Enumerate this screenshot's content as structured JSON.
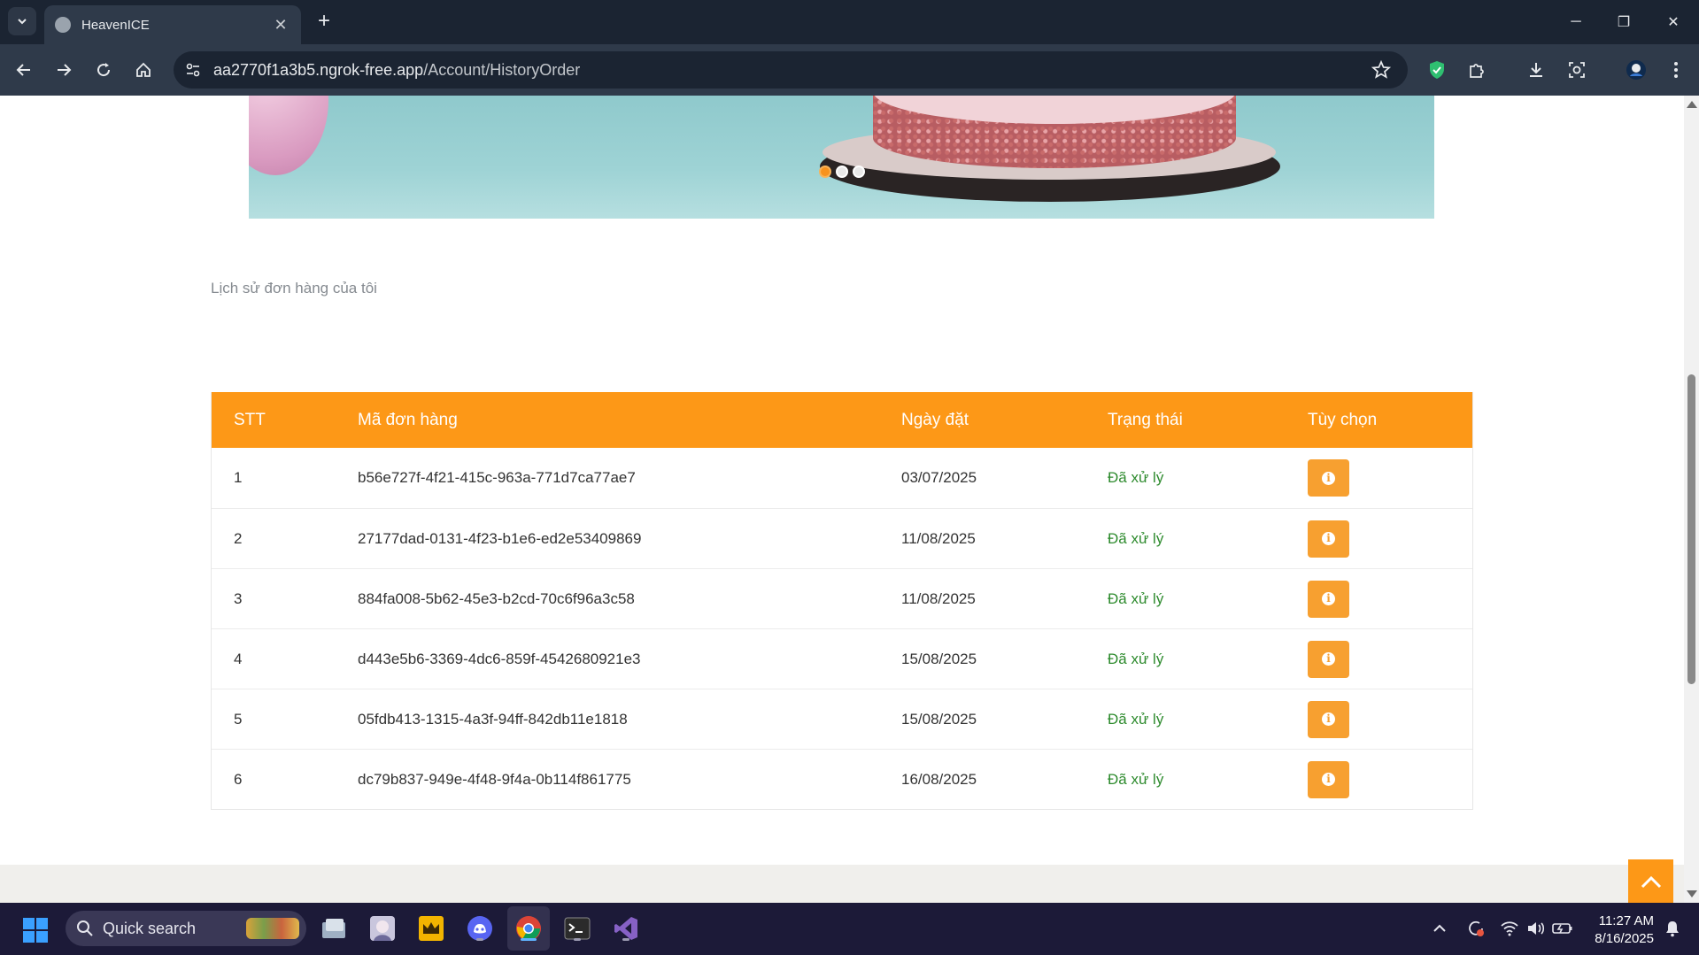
{
  "browser": {
    "tab_title": "HeavenICE",
    "tab_close": "✕",
    "new_tab": "+",
    "url_host": "aa2770f1a3b5.ngrok-free.app",
    "url_path": "/Account/HistoryOrder",
    "window_controls": {
      "minimize": "─",
      "restore": "❐",
      "close": "✕"
    }
  },
  "page": {
    "title": "Lịch sử đơn hàng của tôi",
    "carousel": {
      "slide_count": 3,
      "active_slide": 1
    },
    "table": {
      "headers": [
        "STT",
        "Mã đơn hàng",
        "Ngày đặt",
        "Trạng thái",
        "Tùy chọn"
      ],
      "rows": [
        {
          "stt": "1",
          "order_id": "b56e727f-4f21-415c-963a-771d7ca77ae7",
          "date": "03/07/2025",
          "status": "Đã xử lý"
        },
        {
          "stt": "2",
          "order_id": "27177dad-0131-4f23-b1e6-ed2e53409869",
          "date": "11/08/2025",
          "status": "Đã xử lý"
        },
        {
          "stt": "3",
          "order_id": "884fa008-5b62-45e3-b2cd-70c6f96a3c58",
          "date": "11/08/2025",
          "status": "Đã xử lý"
        },
        {
          "stt": "4",
          "order_id": "d443e5b6-3369-4dc6-859f-4542680921e3",
          "date": "15/08/2025",
          "status": "Đã xử lý"
        },
        {
          "stt": "5",
          "order_id": "05fdb413-1315-4a3f-94ff-842db11e1818",
          "date": "15/08/2025",
          "status": "Đã xử lý"
        },
        {
          "stt": "6",
          "order_id": "dc79b837-949e-4f48-9f4a-0b114f861775",
          "date": "16/08/2025",
          "status": "Đã xử lý"
        }
      ],
      "info_glyph": "i"
    },
    "colors": {
      "accent": "#fd9817",
      "status_done": "#2e8b2e"
    }
  },
  "taskbar": {
    "search_label": "Quick search",
    "time": "11:27 AM",
    "date": "8/16/2025",
    "apps": [
      "file-explorer-icon",
      "anime-app-icon",
      "crown-app-icon",
      "discord-icon",
      "chrome-icon",
      "terminal-icon",
      "visual-studio-icon"
    ]
  }
}
